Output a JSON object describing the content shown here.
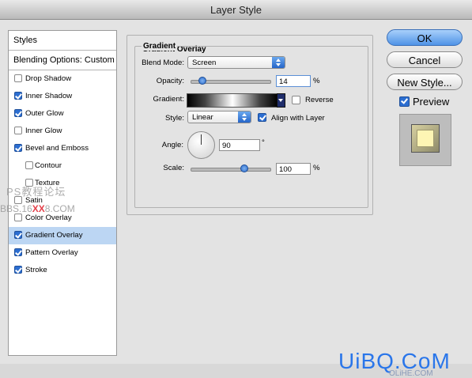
{
  "window": {
    "title": "Layer Style"
  },
  "styles_list": {
    "header": "Styles",
    "blending_options": "Blending Options: Custom",
    "items": [
      {
        "label": "Drop Shadow",
        "checked": false,
        "sub": false,
        "selected": false
      },
      {
        "label": "Inner Shadow",
        "checked": true,
        "sub": false,
        "selected": false
      },
      {
        "label": "Outer Glow",
        "checked": true,
        "sub": false,
        "selected": false
      },
      {
        "label": "Inner Glow",
        "checked": false,
        "sub": false,
        "selected": false
      },
      {
        "label": "Bevel and Emboss",
        "checked": true,
        "sub": false,
        "selected": false
      },
      {
        "label": "Contour",
        "checked": false,
        "sub": true,
        "selected": false
      },
      {
        "label": "Texture",
        "checked": false,
        "sub": true,
        "selected": false
      },
      {
        "label": "Satin",
        "checked": false,
        "sub": false,
        "selected": false
      },
      {
        "label": "Color Overlay",
        "checked": false,
        "sub": false,
        "selected": false
      },
      {
        "label": "Gradient Overlay",
        "checked": true,
        "sub": false,
        "selected": true
      },
      {
        "label": "Pattern Overlay",
        "checked": true,
        "sub": false,
        "selected": false
      },
      {
        "label": "Stroke",
        "checked": true,
        "sub": false,
        "selected": false
      }
    ]
  },
  "panel": {
    "title": "Gradient Overlay",
    "section": "Gradient",
    "blend_mode_label": "Blend Mode:",
    "blend_mode_value": "Screen",
    "opacity_label": "Opacity:",
    "opacity_value": "14",
    "opacity_percent": 14,
    "opacity_unit": "%",
    "gradient_label": "Gradient:",
    "reverse_label": "Reverse",
    "reverse_checked": false,
    "style_label": "Style:",
    "style_value": "Linear",
    "align_label": "Align with Layer",
    "align_checked": true,
    "angle_label": "Angle:",
    "angle_value": "90",
    "angle_unit": "°",
    "scale_label": "Scale:",
    "scale_value": "100",
    "scale_percent": 100,
    "scale_unit": "%"
  },
  "buttons": {
    "ok": "OK",
    "cancel": "Cancel",
    "new_style": "New Style...",
    "preview_label": "Preview",
    "preview_checked": true
  },
  "watermarks": {
    "cn_forum": "PS教程论坛",
    "url_prefix": "BBS.16",
    "url_red": "XX",
    "url_suffix": "8.COM",
    "brand": "UiBQ.CoM",
    "brand_sub": "OLiHE.COM"
  }
}
